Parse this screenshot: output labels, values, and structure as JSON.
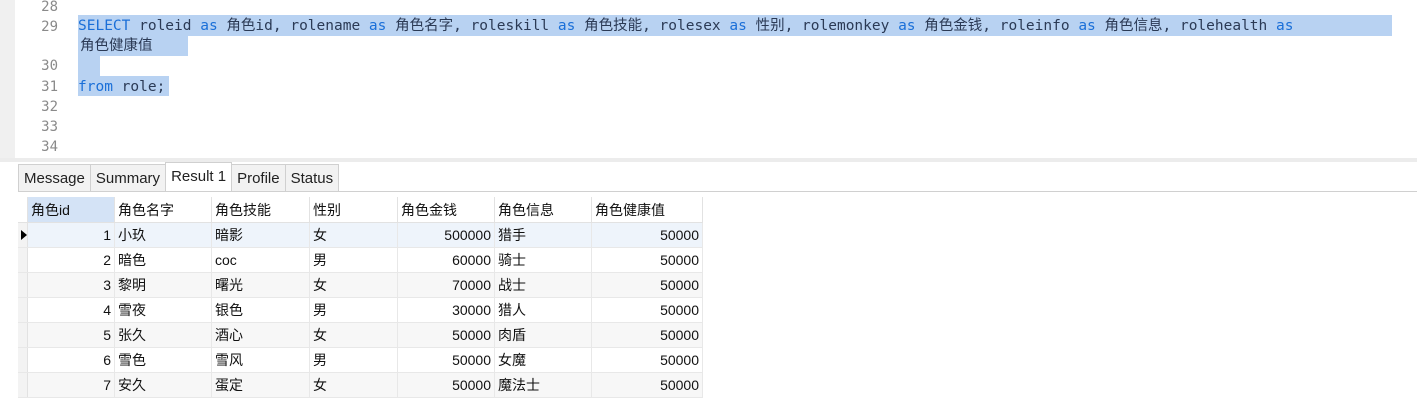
{
  "editor": {
    "line_numbers": [
      "28",
      "29",
      "30",
      "31",
      "32",
      "33",
      "34"
    ],
    "line29_a": "SELECT",
    "line29_b": " roleid ",
    "as": "as",
    "line29_c": " 角色id, rolename ",
    "line29_d": " 角色名字, roleskill ",
    "line29_e": " 角色技能, rolesex ",
    "line29_f": " 性别, rolemonkey ",
    "line29_g": " 角色金钱, roleinfo ",
    "line29_h": " 角色信息, rolehealth ",
    "line29_wrap": " 角色健康值 ",
    "line31_kw": "from",
    "line31_rest": " role;"
  },
  "tabs": [
    "Message",
    "Summary",
    "Result 1",
    "Profile",
    "Status"
  ],
  "active_tab": "Result 1",
  "grid": {
    "columns": [
      "角色id",
      "角色名字",
      "角色技能",
      "性别",
      "角色金钱",
      "角色信息",
      "角色健康值"
    ],
    "rows": [
      [
        "1",
        "小玖",
        "暗影",
        "女",
        "500000",
        "猎手",
        "50000"
      ],
      [
        "2",
        "暗色",
        "coc",
        "男",
        "60000",
        "骑士",
        "50000"
      ],
      [
        "3",
        "黎明",
        "曙光",
        "女",
        "70000",
        "战士",
        "50000"
      ],
      [
        "4",
        "雪夜",
        "银色",
        "男",
        "30000",
        "猎人",
        "50000"
      ],
      [
        "5",
        "张久",
        "酒心",
        "女",
        "50000",
        "肉盾",
        "50000"
      ],
      [
        "6",
        "雪色",
        "雪风",
        "男",
        "50000",
        "女魔",
        "50000"
      ],
      [
        "7",
        "安久",
        "蛋定",
        "女",
        "50000",
        "魔法士",
        "50000"
      ]
    ]
  },
  "colors": {
    "keyword": "#1a6fd8",
    "selection": "#b8d2f2",
    "header_highlight": "#d4e3f6"
  }
}
